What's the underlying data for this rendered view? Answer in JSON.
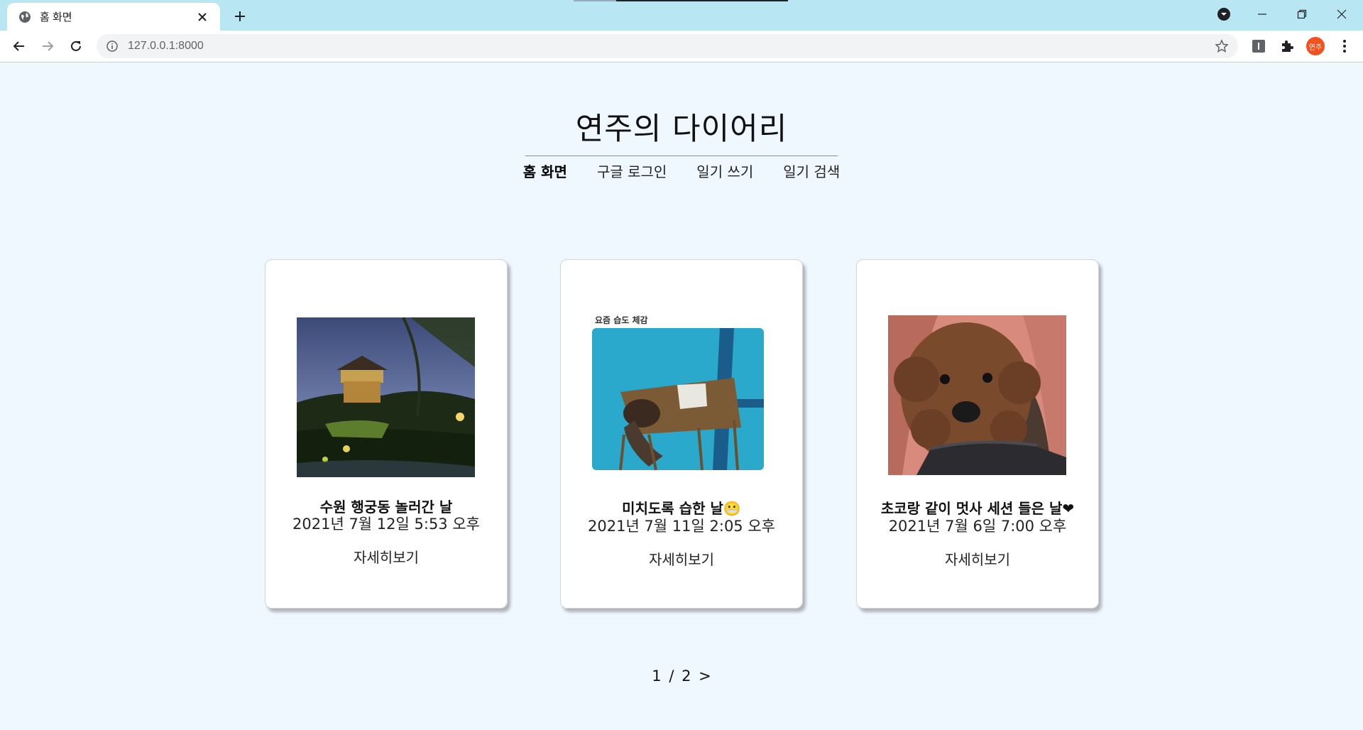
{
  "browser": {
    "tab_title": "홈 화면",
    "url": "127.0.0.1:8000",
    "profile_label": "연주"
  },
  "site": {
    "title": "연주의 다이어리",
    "nav": [
      "홈 화면",
      "구글 로그인",
      "일기 쓰기",
      "일기 검색"
    ]
  },
  "cards": [
    {
      "title": "수원 행궁동 놀러간 날",
      "date": "2021년 7월 12일 5:53 오후",
      "link": "자세히보기"
    },
    {
      "title": "미치도록 습한 날😬",
      "date": "2021년 7월 11일 2:05 오후",
      "link": "자세히보기",
      "image_caption": "요즘 습도 체감"
    },
    {
      "title": "초코랑 같이 멋사 세션 들은 날❤",
      "date": "2021년 7월 6일 7:00 오후",
      "link": "자세히보기"
    }
  ],
  "pagination": {
    "current": "1",
    "separator": "/",
    "total": "2",
    "next": ">"
  },
  "colors": {
    "page_bg": "#f0f8ff",
    "tabbar_bg": "#b8e6f2",
    "profile": "#f4511e"
  }
}
